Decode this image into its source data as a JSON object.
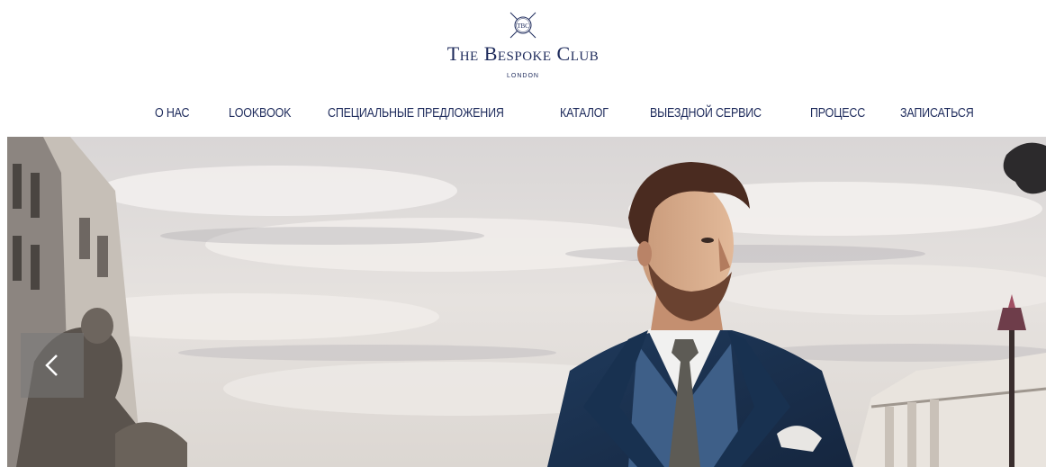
{
  "brand": {
    "emblem_monogram": "TBC",
    "title": "The Bespoke Club",
    "subtitle": "LONDON",
    "color": "#1d2a5b"
  },
  "nav": {
    "items": [
      {
        "label": "О НАС"
      },
      {
        "label": "LOOKBOOK"
      },
      {
        "label": "СПЕЦИАЛЬНЫЕ ПРЕДЛОЖЕНИЯ"
      },
      {
        "label": "КАТАЛОГ"
      },
      {
        "label": "ВЫЕЗДНОЙ СЕРВИС"
      },
      {
        "label": "ПРОЦЕСС"
      },
      {
        "label": "ЗАПИСАТЬСЯ"
      }
    ]
  },
  "hero": {
    "prev_icon": "chevron-left-icon",
    "scene": "man-in-suit-slide-image"
  }
}
